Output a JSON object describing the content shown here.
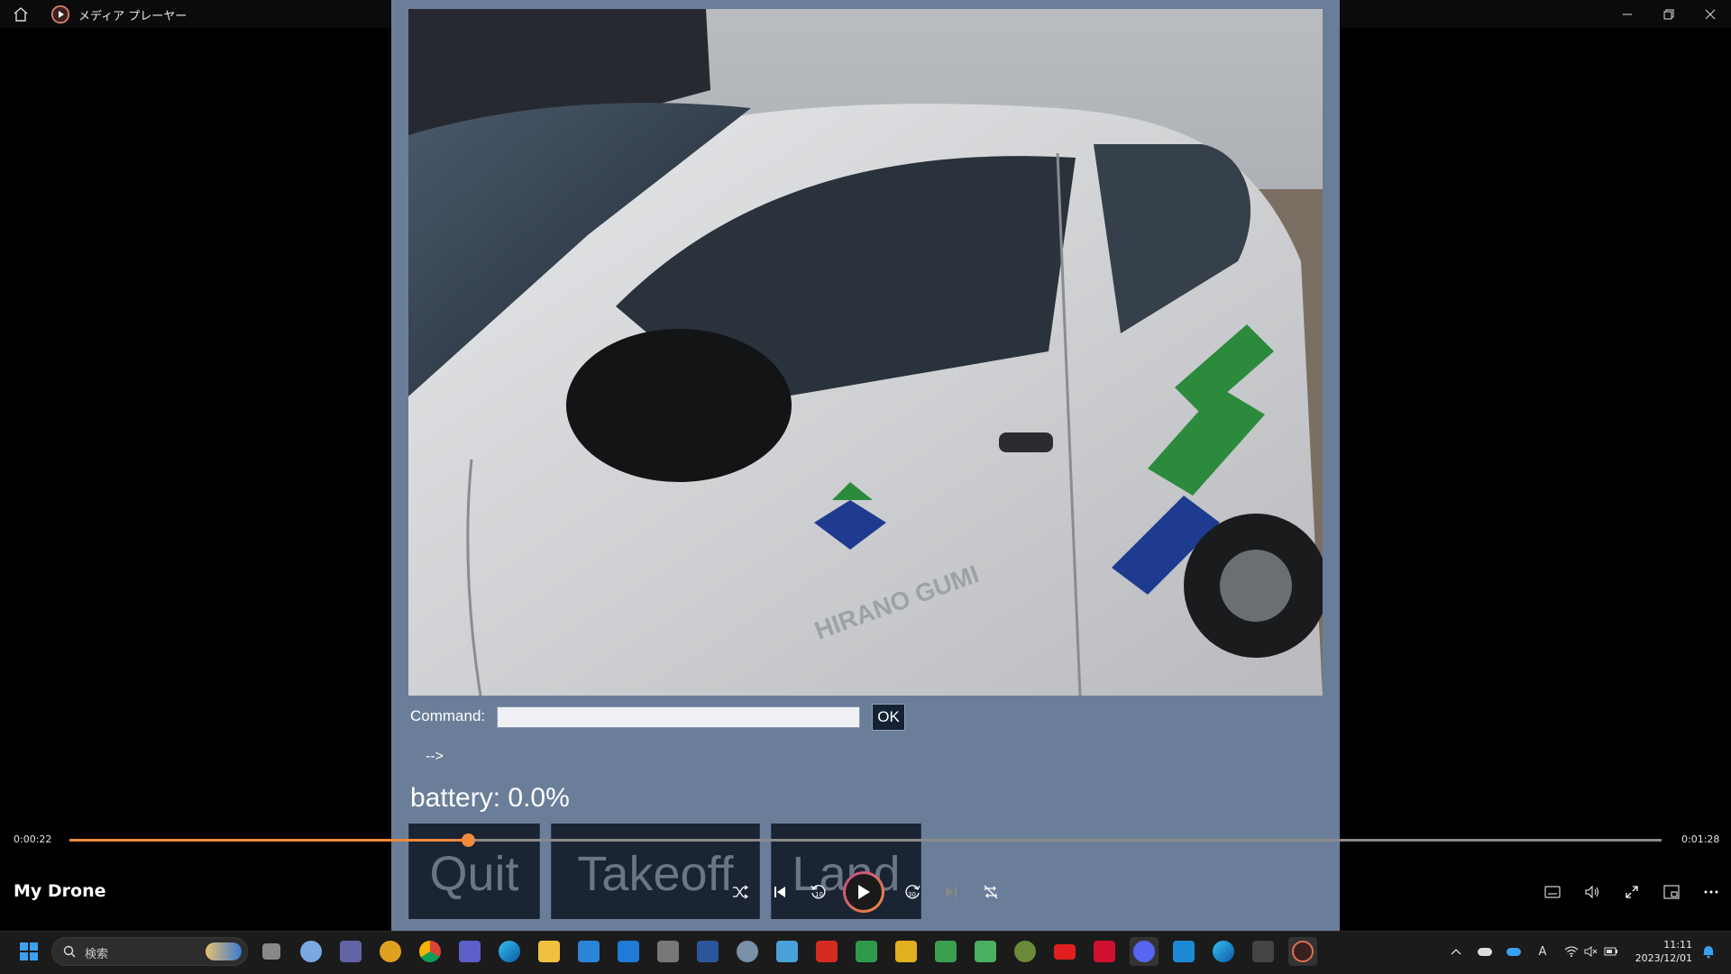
{
  "window": {
    "title": "メディア プレーヤー",
    "icons": {
      "home": "home-icon",
      "app": "play-circle-icon"
    },
    "controls": [
      "minimize-icon",
      "restore-icon",
      "close-icon"
    ]
  },
  "app": {
    "command_label": "Command:",
    "command_value": "",
    "ok_label": "OK",
    "arrow_text": "-->",
    "battery_text": "battery: 0.0%",
    "buttons": {
      "quit": "Quit",
      "takeoff": "Takeoff",
      "land": "Land"
    },
    "camera_feed_text": "HIRANO GUMI"
  },
  "player": {
    "current_time": "0:00:22",
    "total_time": "0:01:28",
    "progress_fraction": 0.25,
    "media_title": "My Drone",
    "controls": [
      "shuffle-icon",
      "previous-icon",
      "rewind-10-icon",
      "play-icon",
      "forward-30-icon",
      "next-icon",
      "repeat-icon"
    ],
    "right_controls": [
      "subtitles-icon",
      "volume-icon",
      "fullscreen-icon",
      "miniplayer-icon",
      "more-icon"
    ],
    "accent_color": "#f08a3c"
  },
  "taskbar": {
    "search_placeholder": "検索",
    "clock_time": "11:11",
    "clock_date": "2023/12/01",
    "ime_indicator": "A"
  }
}
